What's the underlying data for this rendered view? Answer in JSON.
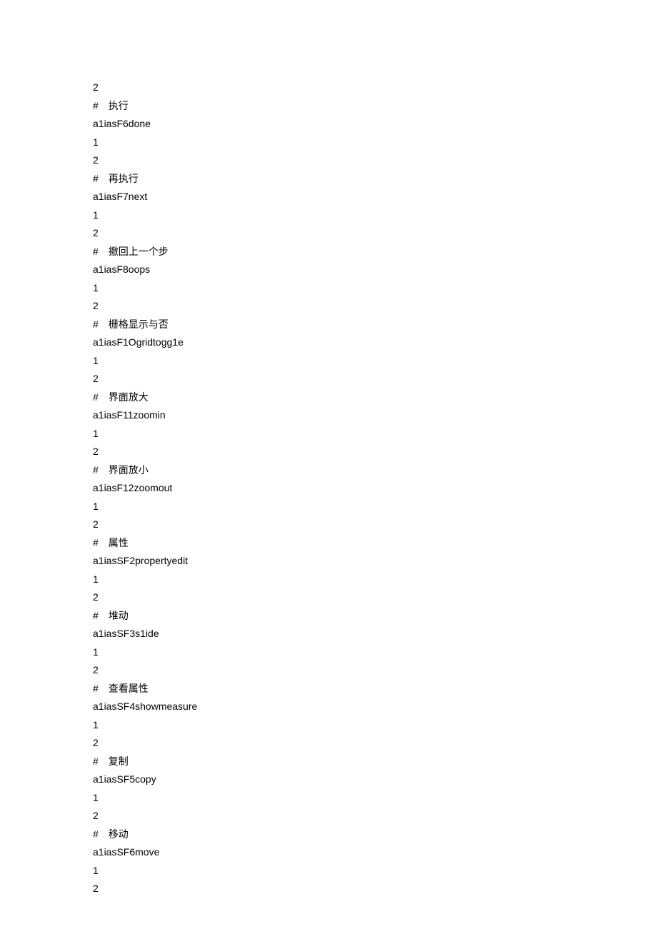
{
  "lines": [
    "2",
    "#　执行",
    "a1iasF6done",
    "1",
    "2",
    "#　再执行",
    "a1iasF7next",
    "1",
    "2",
    "#　撤回上一个步",
    "a1iasF8oops",
    "1",
    "2",
    "#　栅格显示与否",
    "a1iasF1Ogridtogg1e",
    "1",
    "2",
    "#　界面放大",
    "a1iasF11zoomin",
    "1",
    "2",
    "#　界面放小",
    "a1iasF12zoomout",
    "1",
    "2",
    "#　属性",
    "a1iasSF2propertyedit",
    "1",
    "2",
    "#　堆动",
    "a1iasSF3s1ide",
    "1",
    "2",
    "#　查看属性",
    "a1iasSF4showmeasure",
    "1",
    "2",
    "#　复制",
    "a1iasSF5copy",
    "1",
    "2",
    "#　移动",
    "a1iasSF6move",
    "1",
    "2"
  ]
}
